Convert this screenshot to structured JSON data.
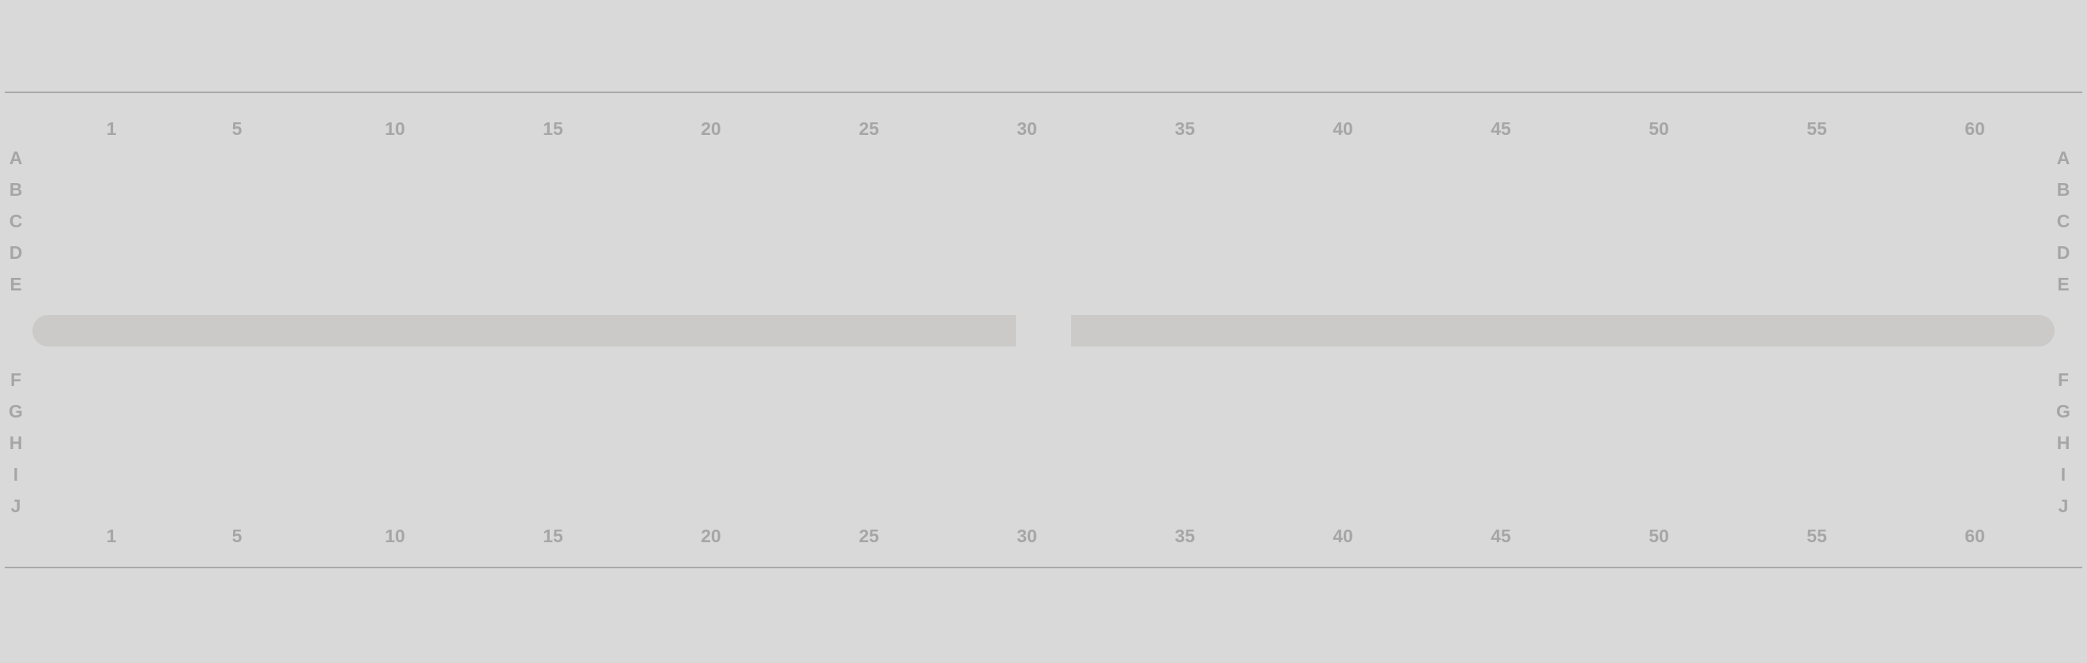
{
  "column_labels": [
    "1",
    "5",
    "10",
    "15",
    "20",
    "25",
    "30",
    "35",
    "40",
    "45",
    "50",
    "55",
    "60"
  ],
  "rows_top": [
    "A",
    "B",
    "C",
    "D",
    "E"
  ],
  "rows_bottom": [
    "F",
    "G",
    "H",
    "I",
    "J"
  ],
  "colors": {
    "background": "#d9d9d9",
    "label": "#a6a6a6",
    "rule": "#a9a9a9",
    "aisle": "#cbcac8"
  }
}
